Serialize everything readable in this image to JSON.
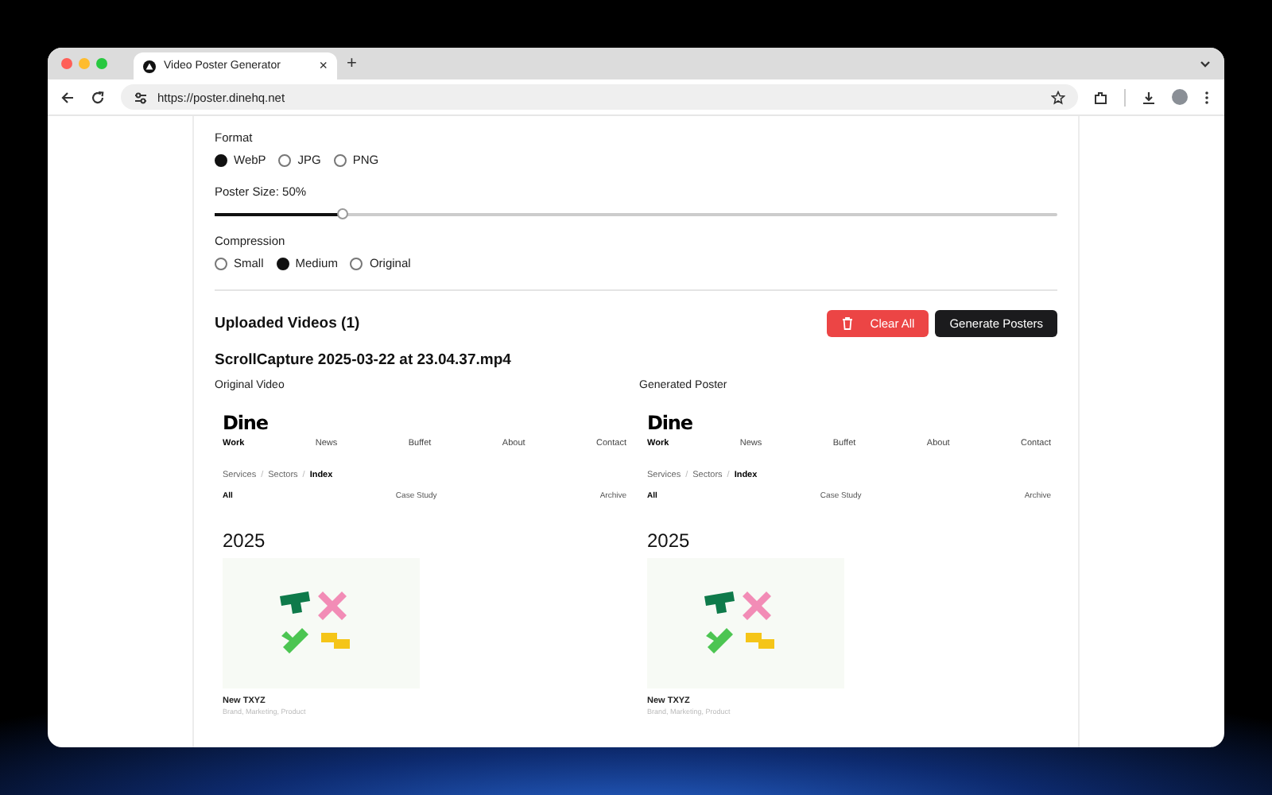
{
  "browser": {
    "tab": {
      "title": "Video Poster Generator",
      "close": "×"
    },
    "new_tab": "+",
    "url": "https://poster.dinehq.net"
  },
  "settings": {
    "format": {
      "label": "Format",
      "options": [
        {
          "label": "WebP",
          "selected": true
        },
        {
          "label": "JPG",
          "selected": false
        },
        {
          "label": "PNG",
          "selected": false
        }
      ]
    },
    "poster_size": {
      "label": "Poster Size: 50%",
      "level": 0.15
    },
    "compression": {
      "label": "Compression",
      "options": [
        {
          "label": "Small",
          "selected": false
        },
        {
          "label": "Medium",
          "selected": true
        },
        {
          "label": "Original",
          "selected": false
        }
      ]
    }
  },
  "uploads": {
    "title": "Uploaded Videos (1)",
    "buttons": [
      {
        "label": "Clear All",
        "kind": "danger"
      },
      {
        "label": "Generate Posters",
        "kind": "primary"
      }
    ],
    "videos": [
      {
        "filename": "ScrollCapture 2025-03-22 at 23.04.37.mp4",
        "panels": [
          {
            "label": "Original Video",
            "site": {
              "logo": "Dine",
              "nav": [
                {
                  "label": "Work",
                  "selected": true
                },
                {
                  "label": "News",
                  "selected": false
                },
                {
                  "label": "Buffet",
                  "selected": false
                },
                {
                  "label": "About",
                  "selected": false
                },
                {
                  "label": "Contact",
                  "selected": false
                }
              ],
              "breadcrumbs": [
                {
                  "label": "Services",
                  "kind": "link"
                },
                {
                  "label": "/",
                  "kind": "separator"
                },
                {
                  "label": "Sectors",
                  "kind": "link"
                },
                {
                  "label": "/",
                  "kind": "separator"
                },
                {
                  "label": "Index",
                  "kind": "current"
                }
              ],
              "filters": [
                {
                  "label": "All",
                  "selected": true
                },
                {
                  "label": "Case Study",
                  "selected": false
                },
                {
                  "label": "Archive",
                  "selected": false
                }
              ],
              "year": "2025",
              "project": {
                "title": "New TXYZ",
                "tags": "Brand, Marketing, Product"
              }
            }
          },
          {
            "label": "Generated Poster",
            "site": {
              "logo": "Dine",
              "nav": [
                {
                  "label": "Work",
                  "selected": true
                },
                {
                  "label": "News",
                  "selected": false
                },
                {
                  "label": "Buffet",
                  "selected": false
                },
                {
                  "label": "About",
                  "selected": false
                },
                {
                  "label": "Contact",
                  "selected": false
                }
              ],
              "breadcrumbs": [
                {
                  "label": "Services",
                  "kind": "link"
                },
                {
                  "label": "/",
                  "kind": "separator"
                },
                {
                  "label": "Sectors",
                  "kind": "link"
                },
                {
                  "label": "/",
                  "kind": "separator"
                },
                {
                  "label": "Index",
                  "kind": "current"
                }
              ],
              "filters": [
                {
                  "label": "All",
                  "selected": true
                },
                {
                  "label": "Case Study",
                  "selected": false
                },
                {
                  "label": "Archive",
                  "selected": false
                }
              ],
              "year": "2025",
              "project": {
                "title": "New TXYZ",
                "tags": "Brand, Marketing, Product"
              }
            }
          }
        ]
      }
    ]
  }
}
